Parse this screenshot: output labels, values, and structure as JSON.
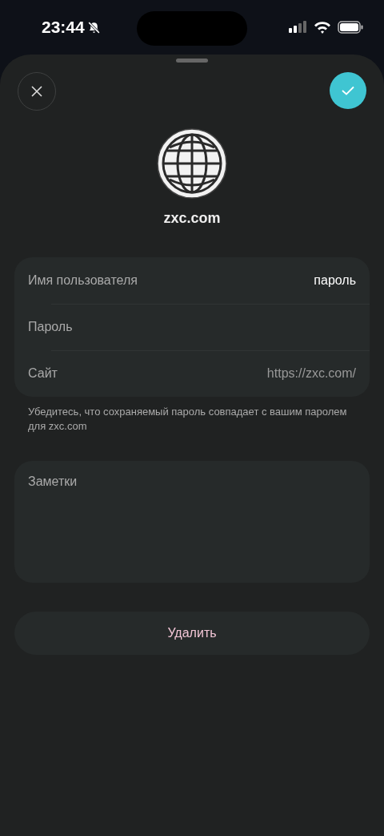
{
  "status_bar": {
    "time": "23:44",
    "silent": true
  },
  "sheet": {
    "site_title": "zxc.com"
  },
  "fields": [
    {
      "label": "Имя пользователя",
      "value": "пароль"
    },
    {
      "label": "Пароль"
    },
    {
      "label": "Сайт",
      "placeholder": "https://zxc.com/"
    }
  ],
  "hint": "Убедитесь, что сохраняемый пароль совпадает с вашим паролем для zxc.com",
  "notes": {
    "placeholder": "Заметки"
  },
  "delete_button": "Удалить"
}
